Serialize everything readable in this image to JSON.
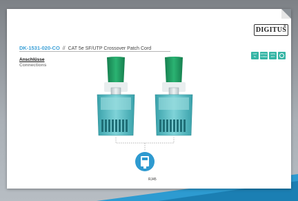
{
  "product": {
    "sku": "DK-1531-020-CO",
    "separator": "//",
    "description": "CAT 5e SF/UTP Crossover Patch Cord"
  },
  "brand": {
    "logo_text": "DIGITUS",
    "registered_mark": "®"
  },
  "section": {
    "label_de": "Anschlüsse",
    "label_en": "Connections"
  },
  "badges": [
    {
      "icon": "cat5e-badge",
      "line1": "CAT",
      "line2": "5e"
    },
    {
      "icon": "patch-cable-badge",
      "line1": "PATCH",
      "line2": "CABLE"
    },
    {
      "icon": "awg-badge",
      "line1": "AWG",
      "line2": "26/7"
    },
    {
      "icon": "halogen-free-badge",
      "line1": "",
      "line2": ""
    }
  ],
  "connector_label": "RJ45",
  "colors": {
    "sku": "#3a9fd6",
    "boot_green": "#1f9a62",
    "connector_teal": "#4fb8c0",
    "badge_teal": "#35b5a5",
    "accent_stripe": "#1f8ec4"
  }
}
